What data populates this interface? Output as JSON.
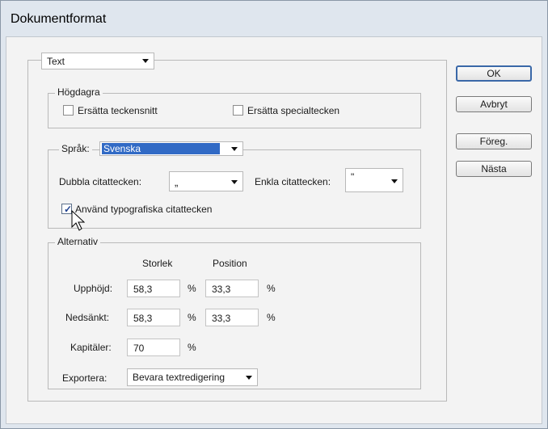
{
  "window": {
    "title": "Dokumentformat"
  },
  "format_select": {
    "value": "Text"
  },
  "hogdagra": {
    "legend": "Högdagra",
    "replace_fonts": "Ersätta teckensnitt",
    "replace_special": "Ersätta specialtecken"
  },
  "language": {
    "label": "Språk:",
    "value": "Svenska",
    "double_quotes_label": "Dubbla citattecken:",
    "double_quotes_value": "„",
    "single_quotes_label": "Enkla citattecken:",
    "single_quotes_value": "\"",
    "typographic_label": "Använd typografiska citattecken"
  },
  "alternativ": {
    "legend": "Alternativ",
    "col_size": "Storlek",
    "col_position": "Position",
    "superscript_label": "Upphöjd:",
    "superscript_size": "58,3",
    "superscript_position": "33,3",
    "subscript_label": "Nedsänkt:",
    "subscript_size": "58,3",
    "subscript_position": "33,3",
    "smallcaps_label": "Kapitäler:",
    "smallcaps_value": "70",
    "percent": "%",
    "export_label": "Exportera:",
    "export_value": "Bevara textredigering"
  },
  "buttons": {
    "ok": "OK",
    "cancel": "Avbryt",
    "prev": "Föreg.",
    "next": "Nästa"
  }
}
